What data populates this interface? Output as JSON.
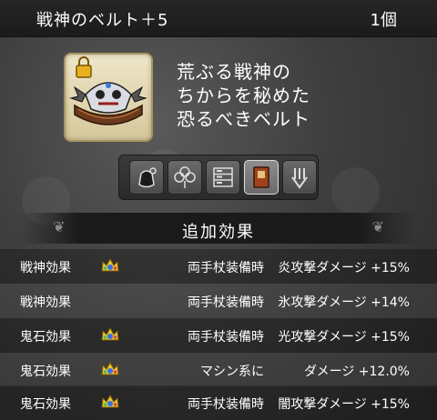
{
  "item": {
    "name": "戦神のベルト＋5",
    "count": "1個",
    "description": [
      "荒ぶる戦神の",
      "ちからを秘めた",
      "恐るべきベルト"
    ]
  },
  "icons": [
    "bag-icon",
    "clover-icon",
    "storage-icon",
    "book-icon",
    "hand-icon"
  ],
  "section_title": "追加効果",
  "effects": [
    {
      "label": "戦神効果",
      "has_crown": true,
      "condition": "両手杖装備時",
      "effect": "炎攻撃ダメージ +15%"
    },
    {
      "label": "戦神効果",
      "has_crown": false,
      "condition": "両手杖装備時",
      "effect": "氷攻撃ダメージ +14%"
    },
    {
      "label": "鬼石効果",
      "has_crown": true,
      "condition": "両手杖装備時",
      "effect": "光攻撃ダメージ +15%"
    },
    {
      "label": "鬼石効果",
      "has_crown": true,
      "condition": "マシン系に",
      "effect": "ダメージ +12.0%"
    },
    {
      "label": "鬼石効果",
      "has_crown": true,
      "condition": "両手杖装備時",
      "effect": "闇攻撃ダメージ +15%"
    }
  ]
}
